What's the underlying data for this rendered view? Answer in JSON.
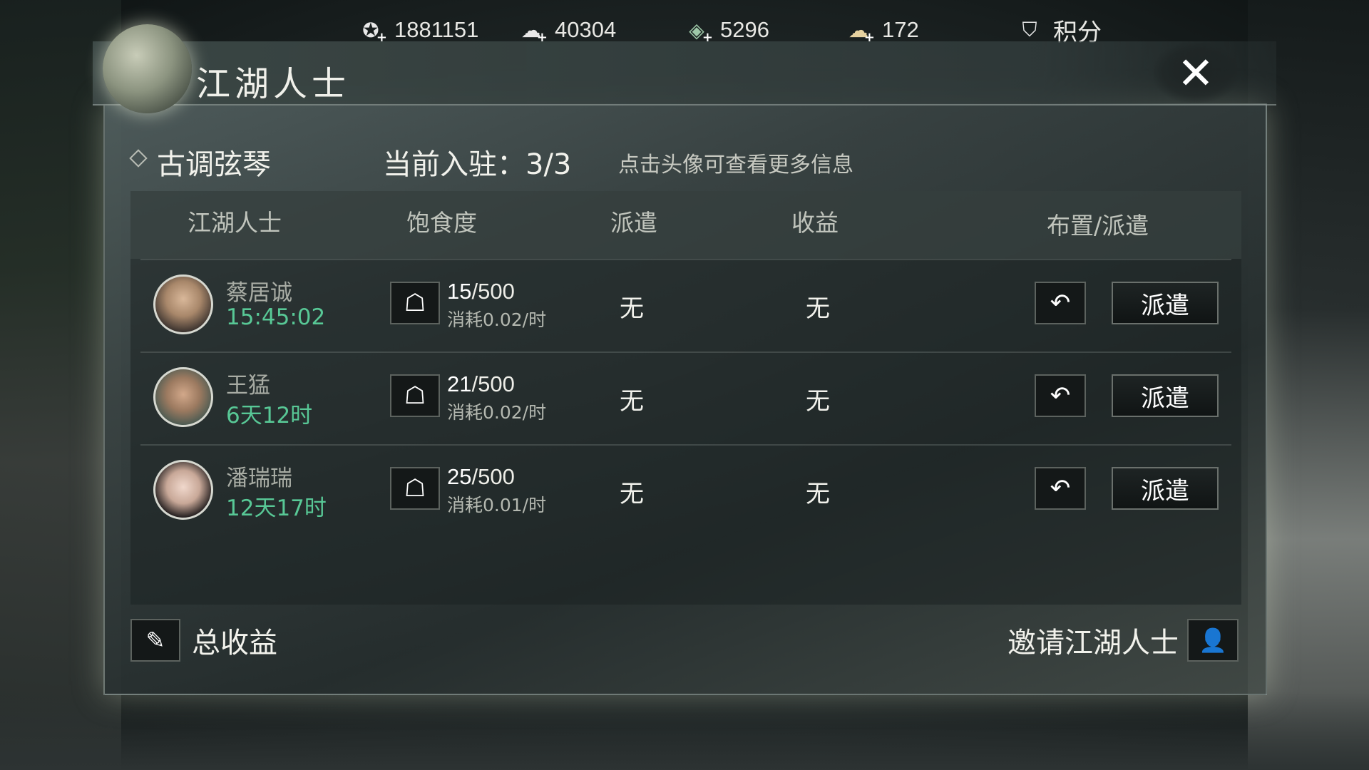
{
  "currencies": [
    {
      "icon": "copper-coin-icon",
      "value": "1881151"
    },
    {
      "icon": "silver-ingot-icon",
      "value": "40304"
    },
    {
      "icon": "jade-icon",
      "value": "5296"
    },
    {
      "icon": "gold-ingot-icon",
      "value": "172"
    }
  ],
  "score": {
    "icon": "shield-badge-icon",
    "label": "积分"
  },
  "panel": {
    "title": "江湖人士",
    "close_symbol": "✕",
    "building_name": "古调弦琴",
    "occupancy": "当前入驻：3/3",
    "hint": "点击头像可查看更多信息"
  },
  "table": {
    "headers": {
      "npc": "江湖人士",
      "satiety": "饱食度",
      "dispatch": "派遣",
      "income": "收益",
      "arrange": "布置/派遣"
    },
    "rows": [
      {
        "name": "蔡居诚",
        "timer": "15:45:02",
        "satiety_current": "15",
        "satiety_max": "/500",
        "rate": "消耗0.02/时",
        "dispatch": "无",
        "income": "无",
        "dispatch_button": "派遣"
      },
      {
        "name": "王猛",
        "timer": "6天12时",
        "satiety_current": "21",
        "satiety_max": "/500",
        "rate": "消耗0.02/时",
        "dispatch": "无",
        "income": "无",
        "dispatch_button": "派遣"
      },
      {
        "name": "潘瑞瑞",
        "timer": "12天17时",
        "satiety_current": "25",
        "satiety_max": "/500",
        "rate": "消耗0.01/时",
        "dispatch": "无",
        "income": "无",
        "dispatch_button": "派遣"
      }
    ]
  },
  "footer": {
    "total_income": "总收益",
    "invite": "邀请江湖人士"
  },
  "colors": {
    "timer": "#58c896",
    "accent_text": "#f2f2ec"
  }
}
